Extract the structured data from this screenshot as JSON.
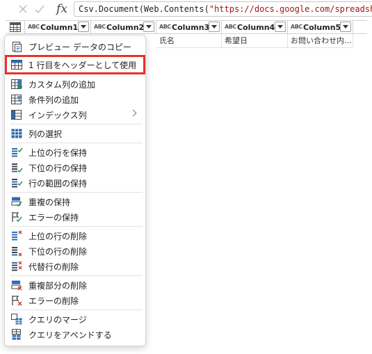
{
  "formula_bar": {
    "function_text": "Csv.Document(Web.Contents(",
    "string_text": "\"https://docs.google.com/spreadsh",
    "fx_label": "fx"
  },
  "columns": [
    {
      "type": "ABC",
      "name": "Column1"
    },
    {
      "type": "ABC",
      "name": "Column2"
    },
    {
      "type": "ABC",
      "name": "Column3"
    },
    {
      "type": "ABC",
      "name": "Column4"
    },
    {
      "type": "ABC",
      "name": "Column5"
    }
  ],
  "first_row": [
    "氏名",
    "希望日",
    "お問い合わせ内..."
  ],
  "menu": {
    "items": [
      {
        "label": "プレビュー データのコピー",
        "icon": "copy-preview-icon"
      },
      {
        "label": "1 行目をヘッダーとして使用",
        "icon": "table-header-icon",
        "highlighted": true
      },
      {
        "label": "カスタム列の追加",
        "icon": "custom-column-icon"
      },
      {
        "label": "条件列の追加",
        "icon": "conditional-column-icon"
      },
      {
        "label": "インデックス列",
        "icon": "index-column-icon",
        "submenu": true
      },
      {
        "label": "列の選択",
        "icon": "choose-columns-icon"
      },
      {
        "label": "上位の行を保持",
        "icon": "keep-top-rows-icon"
      },
      {
        "label": "下位の行の保持",
        "icon": "keep-bottom-rows-icon"
      },
      {
        "label": "行の範囲の保持",
        "icon": "keep-range-rows-icon"
      },
      {
        "label": "重複の保持",
        "icon": "keep-duplicates-icon"
      },
      {
        "label": "エラーの保持",
        "icon": "keep-errors-icon"
      },
      {
        "label": "上位の行の削除",
        "icon": "remove-top-rows-icon"
      },
      {
        "label": "下位の行の削除",
        "icon": "remove-bottom-rows-icon"
      },
      {
        "label": "代替行の削除",
        "icon": "remove-alternate-rows-icon"
      },
      {
        "label": "重複部分の削除",
        "icon": "remove-duplicates-icon"
      },
      {
        "label": "エラーの削除",
        "icon": "remove-errors-icon"
      },
      {
        "label": "クエリのマージ",
        "icon": "merge-queries-icon"
      },
      {
        "label": "クエリをアペンドする",
        "icon": "append-queries-icon"
      }
    ]
  },
  "colors": {
    "highlight_border": "#e8312a",
    "icon_blue": "#2b6cb0",
    "icon_green": "#2e8b57",
    "icon_red": "#d13438"
  }
}
